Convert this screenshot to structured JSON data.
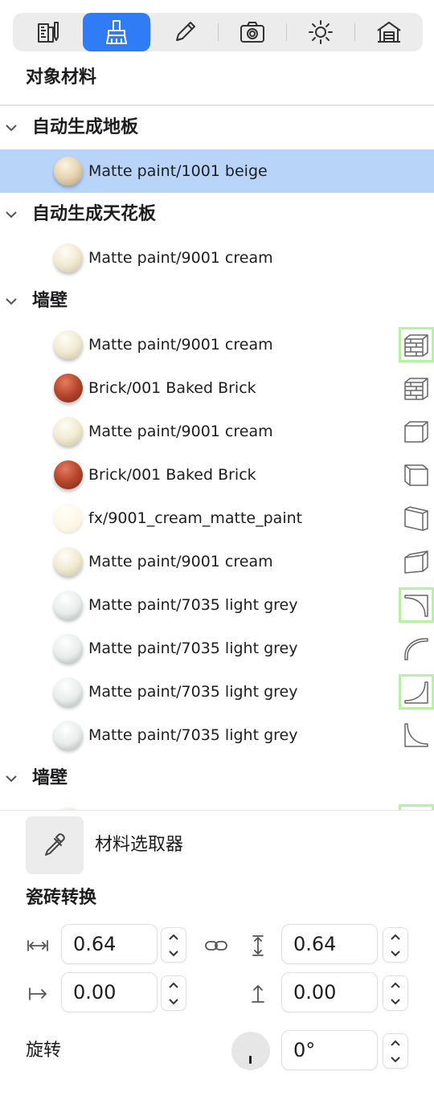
{
  "toolbar": {
    "tabs": [
      {
        "icon": "ruler-pencil-icon",
        "active": false
      },
      {
        "icon": "paint-brush-icon",
        "active": true
      },
      {
        "icon": "pencil-icon",
        "active": false
      },
      {
        "icon": "camera-icon",
        "active": false
      },
      {
        "icon": "sun-icon",
        "active": false
      },
      {
        "icon": "house-icon",
        "active": false
      }
    ],
    "accent": "#2f7cf6"
  },
  "panel": {
    "title": "对象材料"
  },
  "tree": {
    "groups": [
      {
        "label": "自动生成地板",
        "items": [
          {
            "label": "Matte paint/1001 beige",
            "swatch": "beige",
            "selected": true
          }
        ]
      },
      {
        "label": "自动生成天花板",
        "items": [
          {
            "label": "Matte paint/9001 cream",
            "swatch": "cream"
          }
        ]
      },
      {
        "label": "墙壁",
        "items": [
          {
            "label": "Matte paint/9001 cream",
            "swatch": "cream",
            "face": "brick-wall-icon",
            "highlighted": true
          },
          {
            "label": "Brick/001 Baked Brick",
            "swatch": "brick",
            "face": "brick-wall-icon"
          },
          {
            "label": "Matte paint/9001 cream",
            "swatch": "cream",
            "face": "wall-left-face-icon"
          },
          {
            "label": "Brick/001 Baked Brick",
            "swatch": "brick",
            "face": "wall-right-face-icon"
          },
          {
            "label": "fx/9001_cream_matte_paint",
            "swatch": "cream-flat",
            "face": "wall-top-face-icon"
          },
          {
            "label": "Matte paint/9001 cream",
            "swatch": "cream",
            "face": "wall-end-face-icon"
          },
          {
            "label": "Matte paint/7035 light grey",
            "swatch": "grey",
            "face": "cove-top-icon",
            "highlighted": true
          },
          {
            "label": "Matte paint/7035 light grey",
            "swatch": "grey",
            "face": "cove-curve-icon"
          },
          {
            "label": "Matte paint/7035 light grey",
            "swatch": "grey",
            "face": "cove-inner-icon",
            "highlighted": true
          },
          {
            "label": "Matte paint/7035 light grey",
            "swatch": "grey",
            "face": "cove-base-icon"
          }
        ]
      },
      {
        "label": "墙壁",
        "items": []
      }
    ],
    "highlight_color": "#b7f2a4",
    "selected_color": "#b8d5f9"
  },
  "picker": {
    "label": "材料选取器",
    "icon": "eyedropper-icon"
  },
  "tile": {
    "title": "瓷砖转换",
    "width": "0.64",
    "height": "0.64",
    "offset_x": "0.00",
    "offset_y": "0.00",
    "rotation_label": "旋转",
    "rotation": "0°"
  }
}
